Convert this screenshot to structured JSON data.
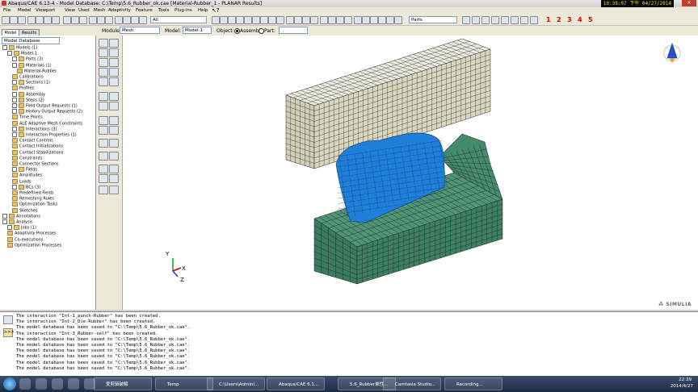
{
  "window": {
    "title": "Abaqus/CAE 6.13-4 - Model Database: C:\\Temp\\5.6_Rubber_ok.cae [Material-Rubber_1 - PLANAR Results]",
    "clock": "10:39:07 下午 04/27/2014"
  },
  "menu": [
    "File",
    "Model",
    "Viewport",
    "View",
    "Used",
    "Mesh",
    "Adaptivity",
    "Feature",
    "Tools",
    "Plug-ins",
    "Help"
  ],
  "toolbar": {
    "render_field": "All",
    "parts_field": "Parts",
    "view_numbers": [
      "1",
      "2",
      "3",
      "4",
      "5"
    ]
  },
  "context": {
    "module_label": "Module:",
    "module_value": "Mesh",
    "model_label": "Model:",
    "model_value": "Model-1",
    "object_label": "Object:",
    "assembly_label": "Assembly",
    "part_label": "Part:"
  },
  "tabs": {
    "model": "Model",
    "results": "Results"
  },
  "model_db_field": "Model Database",
  "tree": [
    {
      "t": "Models (1)",
      "d": 0,
      "k": "b"
    },
    {
      "t": "Model-1",
      "d": 1,
      "k": "b"
    },
    {
      "t": "Parts (3)",
      "d": 2,
      "k": "b"
    },
    {
      "t": "Materials (1)",
      "d": 2,
      "k": "b"
    },
    {
      "t": "Material-Rubber",
      "d": 3,
      "k": "n"
    },
    {
      "t": "Calibrations",
      "d": 2,
      "k": "f"
    },
    {
      "t": "Sections (1)",
      "d": 2,
      "k": "b"
    },
    {
      "t": "Profiles",
      "d": 2,
      "k": "f"
    },
    {
      "t": "Assembly",
      "d": 2,
      "k": "b"
    },
    {
      "t": "Steps (2)",
      "d": 2,
      "k": "b"
    },
    {
      "t": "Field Output Requests (1)",
      "d": 2,
      "k": "b"
    },
    {
      "t": "History Output Requests (2)",
      "d": 2,
      "k": "b"
    },
    {
      "t": "Time Points",
      "d": 2,
      "k": "f"
    },
    {
      "t": "ALE Adaptive Mesh Constraints",
      "d": 2,
      "k": "f"
    },
    {
      "t": "Interactions (3)",
      "d": 2,
      "k": "b"
    },
    {
      "t": "Interaction Properties (1)",
      "d": 2,
      "k": "b"
    },
    {
      "t": "Contact Controls",
      "d": 2,
      "k": "f"
    },
    {
      "t": "Contact Initializations",
      "d": 2,
      "k": "f"
    },
    {
      "t": "Contact Stabilizations",
      "d": 2,
      "k": "f"
    },
    {
      "t": "Constraints",
      "d": 2,
      "k": "f"
    },
    {
      "t": "Connector Sections",
      "d": 2,
      "k": "f"
    },
    {
      "t": "Fields",
      "d": 2,
      "k": "b"
    },
    {
      "t": "Amplitudes",
      "d": 2,
      "k": "f"
    },
    {
      "t": "Loads",
      "d": 2,
      "k": "f"
    },
    {
      "t": "BCs (3)",
      "d": 2,
      "k": "b"
    },
    {
      "t": "Predefined Fields",
      "d": 2,
      "k": "f"
    },
    {
      "t": "Remeshing Rules",
      "d": 2,
      "k": "f"
    },
    {
      "t": "Optimization Tasks",
      "d": 2,
      "k": "f"
    },
    {
      "t": "Sketches",
      "d": 2,
      "k": "f"
    },
    {
      "t": "Annotations",
      "d": 0,
      "k": "b"
    },
    {
      "t": "Analysis",
      "d": 0,
      "k": "b"
    },
    {
      "t": "Jobs (1)",
      "d": 1,
      "k": "b"
    },
    {
      "t": "Adaptivity Processes",
      "d": 1,
      "k": "f"
    },
    {
      "t": "Co-executions",
      "d": 1,
      "k": "f"
    },
    {
      "t": "Optimization Processes",
      "d": 1,
      "k": "f"
    }
  ],
  "triad": {
    "y": "Y",
    "x": "X",
    "z": "Z"
  },
  "brand": "SIMULIA",
  "messages": [
    "The interaction \"Int-1_punch-Rubber\" has been created.",
    "The interaction \"Int-2_Die-Rubber\" has been created.",
    "The model database has been saved to \"C:\\Temp\\5.6_Rubber_ok.cae\".",
    "The interaction \"Int-3_Rubber-self\" has been created.",
    "The model database has been saved to \"C:\\Temp\\5.6_Rubber_ok.cae\".",
    "The model database has been saved to \"C:\\Temp\\5.6_Rubber_ok.cae\".",
    "The model database has been saved to \"C:\\Temp\\5.6_Rubber_ok.cae\".",
    "The model database has been saved to \"C:\\Temp\\5.6_Rubber_ok.cae\".",
    "The model database has been saved to \"C:\\Temp\\5.6_Rubber_ok.cae\".",
    "The model database has been saved to \"C:\\Temp\\5.6_Rubber_ok.cae\"."
  ],
  "taskbar": {
    "items": [
      "爱剪辑破解",
      "Temp",
      "C:\\Users\\Admini...",
      "Abaqus/CAE 6.1...",
      "5.6_Rubber单性...",
      "Camtasia Studio...",
      "Recording..."
    ],
    "time": "22:39",
    "date": "2014/4/27"
  },
  "colors": {
    "punch": "#d9d6bf",
    "rubber": "#1f7fd8",
    "die": "#3d7f63",
    "mesh_line": "#1a1a1a"
  }
}
